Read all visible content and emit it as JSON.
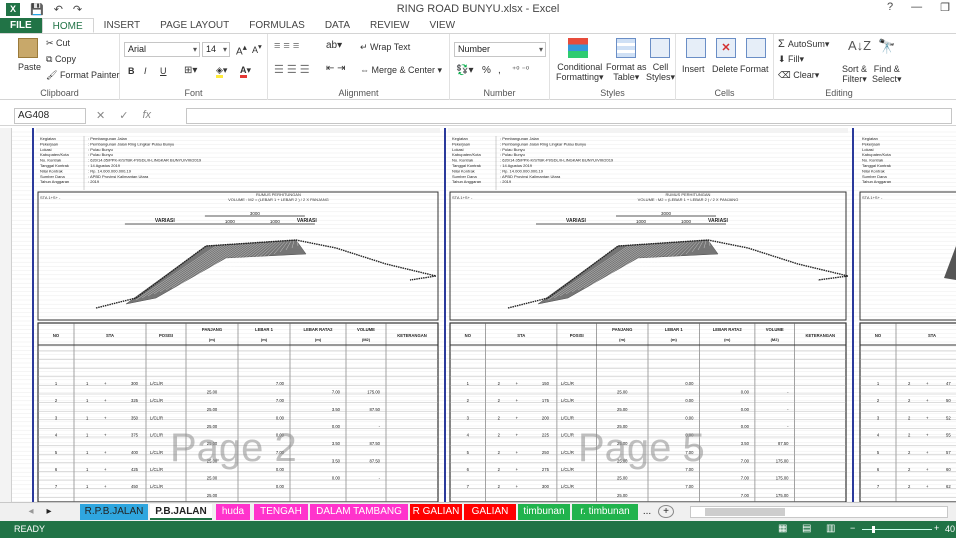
{
  "window": {
    "title": "RING ROAD BUNYU.xlsx - Excel",
    "help": "?",
    "minimize": "—",
    "restore": "❐"
  },
  "quick_access": {
    "app_icon": "X",
    "save": "💾",
    "undo": "↶",
    "redo": "↷"
  },
  "ribbon_tabs": [
    "FILE",
    "HOME",
    "INSERT",
    "PAGE LAYOUT",
    "FORMULAS",
    "DATA",
    "REVIEW",
    "VIEW"
  ],
  "clipboard": {
    "paste": "Paste",
    "cut": "Cut",
    "copy": "Copy",
    "format_painter": "Format Painter",
    "label": "Clipboard"
  },
  "font": {
    "name": "Arial",
    "size": "14",
    "bold": "B",
    "italic": "I",
    "underline": "U",
    "label": "Font"
  },
  "alignment": {
    "wrap_text": "Wrap Text",
    "merge_center": "Merge & Center",
    "label": "Alignment"
  },
  "number": {
    "format": "Number",
    "label": "Number",
    "percent": "%",
    "comma": ","
  },
  "styles": {
    "conditional": [
      "Conditional",
      "Formatting"
    ],
    "format_table": [
      "Format as",
      "Table"
    ],
    "cell_styles": [
      "Cell",
      "Styles"
    ],
    "label": "Styles"
  },
  "cells": {
    "insert": "Insert",
    "delete": "Delete",
    "format": "Format",
    "label": "Cells"
  },
  "editing": {
    "autosum": "AutoSum",
    "fill": "Fill",
    "clear": "Clear",
    "sort_filter": [
      "Sort &",
      "Filter"
    ],
    "find_select": [
      "Find &",
      "Select"
    ],
    "label": "Editing"
  },
  "formula_bar": {
    "name_box": "AG408",
    "cancel": "✕",
    "enter": "✓",
    "fx": "fx",
    "value": ""
  },
  "page_watermarks": [
    "Page 2",
    "Page 5"
  ],
  "table_headers": [
    "NO",
    "STA",
    "POSISI",
    "PANJANG",
    "LEBAR 1",
    "LEBAR RATA2",
    "VOLUME",
    "KETERANGAN"
  ],
  "table_units": [
    "(m)",
    "(m)",
    "(m)",
    "(M2)"
  ],
  "page2_rows": [
    {
      "no": "1",
      "sta_a": "1",
      "sta_b": "300",
      "posisi": "L/CL/R",
      "lebar1": "7.00"
    },
    {
      "panjang": "25.00",
      "rata2": "7.00",
      "volume": "175.00"
    },
    {
      "no": "2",
      "sta_a": "1",
      "sta_b": "325",
      "posisi": "L/CL/R",
      "lebar1": "7.00"
    },
    {
      "panjang": "25.00",
      "rata2": "3.50",
      "volume": "87.50"
    },
    {
      "no": "3",
      "sta_a": "1",
      "sta_b": "350",
      "posisi": "L/CL/R",
      "lebar1": "0.00"
    },
    {
      "panjang": "25.00",
      "rata2": "0.00",
      "volume": "-"
    },
    {
      "no": "4",
      "sta_a": "1",
      "sta_b": "375",
      "posisi": "L/CL/R",
      "lebar1": "0.00"
    },
    {
      "panjang": "25.00",
      "rata2": "3.50",
      "volume": "87.50"
    },
    {
      "no": "5",
      "sta_a": "1",
      "sta_b": "400",
      "posisi": "L/CL/R",
      "lebar1": "7.00"
    },
    {
      "panjang": "25.00",
      "rata2": "3.50",
      "volume": "87.50"
    },
    {
      "no": "6",
      "sta_a": "1",
      "sta_b": "425",
      "posisi": "L/CL/R",
      "lebar1": "0.00"
    },
    {
      "panjang": "25.00",
      "rata2": "0.00",
      "volume": "-"
    },
    {
      "no": "7",
      "sta_a": "1",
      "sta_b": "450",
      "posisi": "L/CL/R",
      "lebar1": "0.00"
    },
    {
      "panjang": "25.00",
      "rata2": "",
      "volume": ""
    }
  ],
  "page5_rows": [
    {
      "no": "1",
      "sta_a": "2",
      "sta_b": "150",
      "posisi": "L/CL/R",
      "lebar1": "0.00"
    },
    {
      "panjang": "25.00",
      "rata2": "0.00",
      "volume": "-"
    },
    {
      "no": "2",
      "sta_a": "2",
      "sta_b": "175",
      "posisi": "L/CL/R",
      "lebar1": "0.00"
    },
    {
      "panjang": "25.00",
      "rata2": "0.00",
      "volume": "-"
    },
    {
      "no": "3",
      "sta_a": "2",
      "sta_b": "200",
      "posisi": "L/CL/R",
      "lebar1": "0.00"
    },
    {
      "panjang": "25.00",
      "rata2": "0.00",
      "volume": "-"
    },
    {
      "no": "4",
      "sta_a": "2",
      "sta_b": "225",
      "posisi": "L/CL/R",
      "lebar1": "0.00"
    },
    {
      "panjang": "25.00",
      "rata2": "3.50",
      "volume": "87.50"
    },
    {
      "no": "5",
      "sta_a": "2",
      "sta_b": "250",
      "posisi": "L/CL/R",
      "lebar1": "7.00"
    },
    {
      "panjang": "25.00",
      "rata2": "7.00",
      "volume": "175.00"
    },
    {
      "no": "6",
      "sta_a": "2",
      "sta_b": "275",
      "posisi": "L/CL/R",
      "lebar1": "7.00"
    },
    {
      "panjang": "25.00",
      "rata2": "7.00",
      "volume": "175.00"
    },
    {
      "no": "7",
      "sta_a": "2",
      "sta_b": "300",
      "posisi": "L/CL/R",
      "lebar1": "7.00"
    },
    {
      "panjang": "25.00",
      "rata2": "7.00",
      "volume": "175.00"
    }
  ],
  "page8_rows": [
    {
      "no": "1",
      "sta_a": "2",
      "sta_b": "47"
    },
    {
      "no": "2",
      "sta_a": "2",
      "sta_b": "50"
    },
    {
      "no": "3",
      "sta_a": "2",
      "sta_b": "52"
    },
    {
      "no": "4",
      "sta_a": "2",
      "sta_b": "55"
    },
    {
      "no": "5",
      "sta_a": "2",
      "sta_b": "57"
    },
    {
      "no": "6",
      "sta_a": "2",
      "sta_b": "60"
    },
    {
      "no": "7",
      "sta_a": "2",
      "sta_b": "62"
    }
  ],
  "info_labels": [
    "Kegiatan",
    "Pekerjaan",
    "Lokasi",
    "Kabupaten/Kota",
    "No. Kontrak",
    "Tanggal Kontrak",
    "Nilai Kontrak",
    "Sumber Dana",
    "Tahun Anggaran"
  ],
  "info_values": [
    "Pembangunan Jalan",
    "Pembangunan Jalan Ring Lingkar Pulau Bunyu",
    "Pulau Bunyu",
    "Pulau Bunyu",
    "620/14.05/PPK-K/STBK-PI/SDL/II-LINGKAR BUNYU/VIII/2019",
    "14 Agustus 2019",
    "Rp. 14.000.000.000,19",
    "APBD Provinsi Kalimantan Utara",
    "2019"
  ],
  "page2_caption": [
    "RUMUS PERHITUNGAN",
    "VOLUME : M2 = (LEBAR 1 + LEBAR 2 ) / 2 X PANJANG"
  ],
  "page5_caption": [
    "RUMUS PERHITUNGAN",
    "VOLUME : M2 = (LEBAR 1 + LEBAR 2 ) / 2 X PANJANG"
  ],
  "sta_label": "STA 1+S+ -",
  "variasi": "VARIASI",
  "dims": [
    "1000",
    "1000",
    "3000"
  ],
  "sheet_tabs": [
    {
      "label": "R.P.B.JALAN",
      "color": "#2fa6df"
    },
    {
      "label": "P.B.JALAN",
      "color": "#d9ecf7",
      "active": true
    },
    {
      "label": "huda",
      "color": "#ff33cc"
    },
    {
      "label": "TENGAH",
      "color": "#ff33cc"
    },
    {
      "label": "DALAM TAMBANG",
      "color": "#ff33cc"
    },
    {
      "label": "R GALIAN",
      "color": "#ff0000"
    },
    {
      "label": "GALIAN",
      "color": "#ff0000"
    },
    {
      "label": "timbunan",
      "color": "#21b34d"
    },
    {
      "label": "r. timbunan",
      "color": "#21b34d"
    }
  ],
  "sheet_tabs_more": "...",
  "status": {
    "ready": "READY",
    "zoom": "40"
  }
}
